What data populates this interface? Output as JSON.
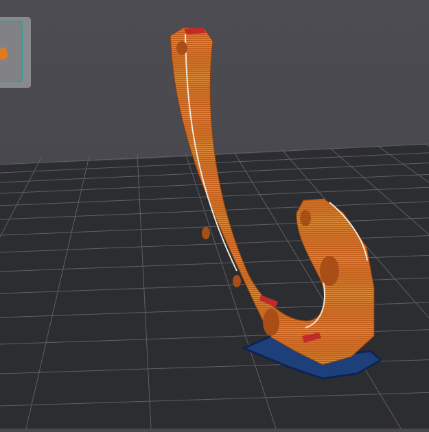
{
  "viewport": {
    "view": "3d-preview",
    "colors": {
      "background": "#47474d",
      "bed": "#2c2d31",
      "grid": "#6a6b70",
      "model": "#c8621c",
      "model_stripe": "#e0a050",
      "first_layer": "#1d3f7a",
      "thumbnail_border": "#2aa39a"
    }
  },
  "thumbnail": {
    "icon": "model-thumbnail-icon"
  }
}
